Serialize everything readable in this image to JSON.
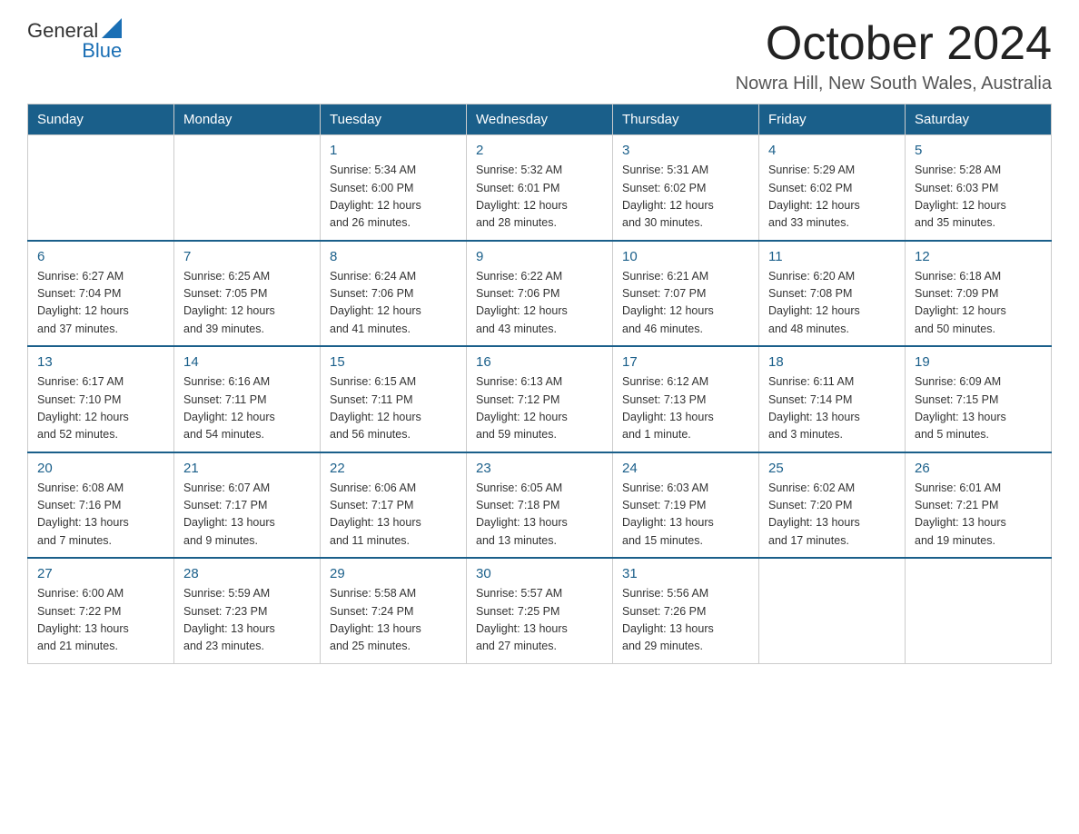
{
  "logo": {
    "text_general": "General",
    "text_blue": "Blue"
  },
  "title": "October 2024",
  "location": "Nowra Hill, New South Wales, Australia",
  "weekdays": [
    "Sunday",
    "Monday",
    "Tuesday",
    "Wednesday",
    "Thursday",
    "Friday",
    "Saturday"
  ],
  "weeks": [
    [
      {
        "day": "",
        "info": ""
      },
      {
        "day": "",
        "info": ""
      },
      {
        "day": "1",
        "info": "Sunrise: 5:34 AM\nSunset: 6:00 PM\nDaylight: 12 hours\nand 26 minutes."
      },
      {
        "day": "2",
        "info": "Sunrise: 5:32 AM\nSunset: 6:01 PM\nDaylight: 12 hours\nand 28 minutes."
      },
      {
        "day": "3",
        "info": "Sunrise: 5:31 AM\nSunset: 6:02 PM\nDaylight: 12 hours\nand 30 minutes."
      },
      {
        "day": "4",
        "info": "Sunrise: 5:29 AM\nSunset: 6:02 PM\nDaylight: 12 hours\nand 33 minutes."
      },
      {
        "day": "5",
        "info": "Sunrise: 5:28 AM\nSunset: 6:03 PM\nDaylight: 12 hours\nand 35 minutes."
      }
    ],
    [
      {
        "day": "6",
        "info": "Sunrise: 6:27 AM\nSunset: 7:04 PM\nDaylight: 12 hours\nand 37 minutes."
      },
      {
        "day": "7",
        "info": "Sunrise: 6:25 AM\nSunset: 7:05 PM\nDaylight: 12 hours\nand 39 minutes."
      },
      {
        "day": "8",
        "info": "Sunrise: 6:24 AM\nSunset: 7:06 PM\nDaylight: 12 hours\nand 41 minutes."
      },
      {
        "day": "9",
        "info": "Sunrise: 6:22 AM\nSunset: 7:06 PM\nDaylight: 12 hours\nand 43 minutes."
      },
      {
        "day": "10",
        "info": "Sunrise: 6:21 AM\nSunset: 7:07 PM\nDaylight: 12 hours\nand 46 minutes."
      },
      {
        "day": "11",
        "info": "Sunrise: 6:20 AM\nSunset: 7:08 PM\nDaylight: 12 hours\nand 48 minutes."
      },
      {
        "day": "12",
        "info": "Sunrise: 6:18 AM\nSunset: 7:09 PM\nDaylight: 12 hours\nand 50 minutes."
      }
    ],
    [
      {
        "day": "13",
        "info": "Sunrise: 6:17 AM\nSunset: 7:10 PM\nDaylight: 12 hours\nand 52 minutes."
      },
      {
        "day": "14",
        "info": "Sunrise: 6:16 AM\nSunset: 7:11 PM\nDaylight: 12 hours\nand 54 minutes."
      },
      {
        "day": "15",
        "info": "Sunrise: 6:15 AM\nSunset: 7:11 PM\nDaylight: 12 hours\nand 56 minutes."
      },
      {
        "day": "16",
        "info": "Sunrise: 6:13 AM\nSunset: 7:12 PM\nDaylight: 12 hours\nand 59 minutes."
      },
      {
        "day": "17",
        "info": "Sunrise: 6:12 AM\nSunset: 7:13 PM\nDaylight: 13 hours\nand 1 minute."
      },
      {
        "day": "18",
        "info": "Sunrise: 6:11 AM\nSunset: 7:14 PM\nDaylight: 13 hours\nand 3 minutes."
      },
      {
        "day": "19",
        "info": "Sunrise: 6:09 AM\nSunset: 7:15 PM\nDaylight: 13 hours\nand 5 minutes."
      }
    ],
    [
      {
        "day": "20",
        "info": "Sunrise: 6:08 AM\nSunset: 7:16 PM\nDaylight: 13 hours\nand 7 minutes."
      },
      {
        "day": "21",
        "info": "Sunrise: 6:07 AM\nSunset: 7:17 PM\nDaylight: 13 hours\nand 9 minutes."
      },
      {
        "day": "22",
        "info": "Sunrise: 6:06 AM\nSunset: 7:17 PM\nDaylight: 13 hours\nand 11 minutes."
      },
      {
        "day": "23",
        "info": "Sunrise: 6:05 AM\nSunset: 7:18 PM\nDaylight: 13 hours\nand 13 minutes."
      },
      {
        "day": "24",
        "info": "Sunrise: 6:03 AM\nSunset: 7:19 PM\nDaylight: 13 hours\nand 15 minutes."
      },
      {
        "day": "25",
        "info": "Sunrise: 6:02 AM\nSunset: 7:20 PM\nDaylight: 13 hours\nand 17 minutes."
      },
      {
        "day": "26",
        "info": "Sunrise: 6:01 AM\nSunset: 7:21 PM\nDaylight: 13 hours\nand 19 minutes."
      }
    ],
    [
      {
        "day": "27",
        "info": "Sunrise: 6:00 AM\nSunset: 7:22 PM\nDaylight: 13 hours\nand 21 minutes."
      },
      {
        "day": "28",
        "info": "Sunrise: 5:59 AM\nSunset: 7:23 PM\nDaylight: 13 hours\nand 23 minutes."
      },
      {
        "day": "29",
        "info": "Sunrise: 5:58 AM\nSunset: 7:24 PM\nDaylight: 13 hours\nand 25 minutes."
      },
      {
        "day": "30",
        "info": "Sunrise: 5:57 AM\nSunset: 7:25 PM\nDaylight: 13 hours\nand 27 minutes."
      },
      {
        "day": "31",
        "info": "Sunrise: 5:56 AM\nSunset: 7:26 PM\nDaylight: 13 hours\nand 29 minutes."
      },
      {
        "day": "",
        "info": ""
      },
      {
        "day": "",
        "info": ""
      }
    ]
  ]
}
